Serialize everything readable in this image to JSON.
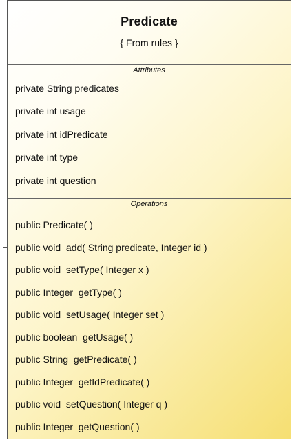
{
  "class": {
    "name": "Predicate",
    "stereotype": "{ From rules }"
  },
  "attributes": {
    "title": "Attributes",
    "items": [
      "private String predicates",
      "private int usage",
      "private int idPredicate",
      "private int type",
      "private int question"
    ]
  },
  "operations": {
    "title": "Operations",
    "items": [
      "public Predicate( )",
      "public void  add( String predicate, Integer id )",
      "public void  setType( Integer x )",
      "public Integer  getType( )",
      "public void  setUsage( Integer set )",
      "public boolean  getUsage( )",
      "public String  getPredicate( )",
      "public Integer  getIdPredicate( )",
      "public void  setQuestion( Integer q )",
      "public Integer  getQuestion( )"
    ]
  },
  "colors": {
    "border": "#555555",
    "fill_light": "#ffffff",
    "fill_dark": "#f6df72",
    "text": "#111111"
  }
}
